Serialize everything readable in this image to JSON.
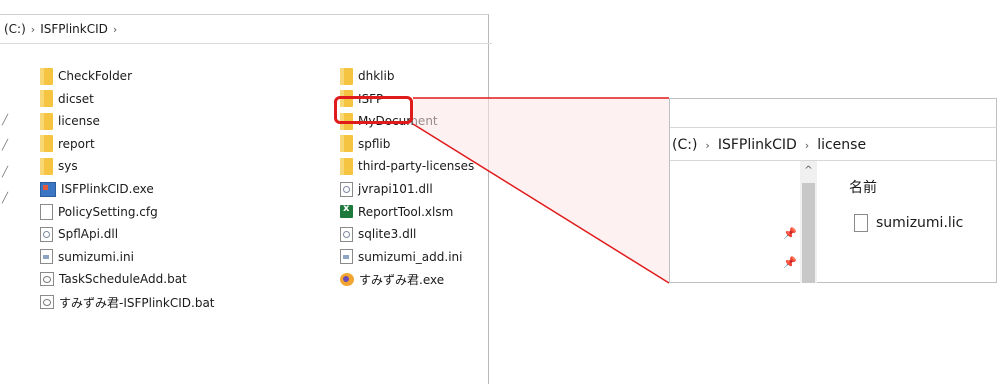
{
  "left_window": {
    "address": {
      "drive": "(C:)",
      "separator": "›",
      "folder": "ISFPlinkCID"
    },
    "left_column": [
      {
        "name": "CheckFolder",
        "icon": "folder-icon"
      },
      {
        "name": "dicset",
        "icon": "folder-icon"
      },
      {
        "name": "license",
        "icon": "folder-icon"
      },
      {
        "name": "report",
        "icon": "folder-icon"
      },
      {
        "name": "sys",
        "icon": "folder-icon"
      },
      {
        "name": "ISFPlinkCID.exe",
        "icon": "exe-icon"
      },
      {
        "name": "PolicySetting.cfg",
        "icon": "file-icon"
      },
      {
        "name": "SpflApi.dll",
        "icon": "dll-icon"
      },
      {
        "name": "sumizumi.ini",
        "icon": "ini-icon"
      },
      {
        "name": "TaskScheduleAdd.bat",
        "icon": "bat-icon"
      },
      {
        "name": "すみずみ君-ISFPlinkCID.bat",
        "icon": "bat-icon"
      }
    ],
    "right_column": [
      {
        "name": "dhklib",
        "icon": "folder-icon"
      },
      {
        "name": "ISFP",
        "icon": "folder-icon"
      },
      {
        "name": "MyDocument",
        "icon": "folder-icon"
      },
      {
        "name": "spflib",
        "icon": "folder-icon"
      },
      {
        "name": "third-party-licenses",
        "icon": "folder-icon"
      },
      {
        "name": "jvrapi101.dll",
        "icon": "dll-icon"
      },
      {
        "name": "ReportTool.xlsm",
        "icon": "excel-icon"
      },
      {
        "name": "sqlite3.dll",
        "icon": "dll-icon"
      },
      {
        "name": "sumizumi_add.ini",
        "icon": "ini-icon"
      },
      {
        "name": "すみずみ君.exe",
        "icon": "sumizumi-app-icon"
      }
    ]
  },
  "zoom_window": {
    "address": {
      "drive": "(C:)",
      "separator": "›",
      "folder": "ISFPlinkCID",
      "subfolder": "license"
    },
    "column_header": "名前",
    "file": "sumizumi.lic",
    "scroll_up_glyph": "^",
    "pin_glyph": "📌"
  },
  "colors": {
    "highlight": "#e01b1b",
    "folder": "#f5c542"
  }
}
